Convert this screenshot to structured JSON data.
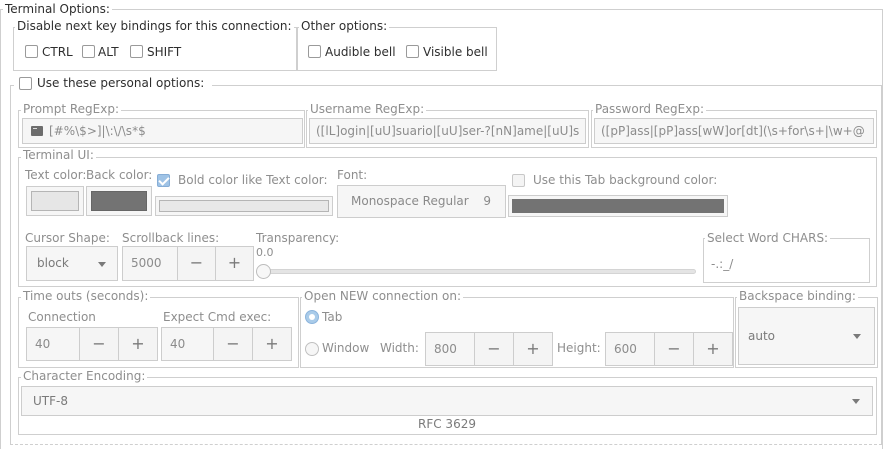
{
  "terminal_options": {
    "title": "Terminal Options:",
    "disable_bindings": {
      "title": "Disable next key bindings for this connection:",
      "ctrl": "CTRL",
      "alt": "ALT",
      "shift": "SHIFT"
    },
    "other_options": {
      "title": "Other options:",
      "audible_bell": "Audible bell",
      "visible_bell": "Visible bell"
    },
    "use_personal": "Use these personal options:"
  },
  "regexp": {
    "prompt_label": "Prompt RegExp:",
    "prompt_value": "[#%\\$>]|\\:\\/\\s*$",
    "username_label": "Username RegExp:",
    "username_value": "([lL]ogin|[uU]suario|[uU]ser-?[nN]ame|[uU]s",
    "password_label": "Password RegExp:",
    "password_value": "([pP]ass|[pP]ass[wW]or[dt](\\s+for\\s+|\\w+@"
  },
  "terminal_ui": {
    "title": "Terminal UI:",
    "text_color_label": "Text color:",
    "back_color_label": "Back color:",
    "bold_like_text": "Bold color like Text color:",
    "font_label": "Font:",
    "font_name": "Monospace Regular",
    "font_size": "9",
    "tab_bg_label": "Use this Tab background color:",
    "cursor_shape_label": "Cursor Shape:",
    "cursor_shape_value": "block",
    "scrollback_label": "Scrollback lines:",
    "scrollback_value": "5000",
    "transparency_label": "Transparency:",
    "transparency_value": "0.0",
    "select_word_label": "Select Word CHARS:",
    "select_word_value": "-.:_/",
    "colors": {
      "text": "#e6e6e6",
      "back": "#737373",
      "bold": "#e8e8e8",
      "tab_bg": "#737373"
    }
  },
  "timeouts": {
    "title": "Time outs (seconds):",
    "connection_label": "Connection",
    "connection_value": "40",
    "expect_label": "Expect Cmd exec:",
    "expect_value": "40"
  },
  "open_new": {
    "title": "Open NEW connection on:",
    "tab": "Tab",
    "window": "Window",
    "width_label": "Width:",
    "width_value": "800",
    "height_label": "Height:",
    "height_value": "600"
  },
  "backspace": {
    "title": "Backspace binding:",
    "value": "auto"
  },
  "encoding": {
    "title": "Character Encoding:",
    "value": "UTF-8",
    "description": "RFC 3629"
  },
  "icons": {
    "minus": "−",
    "plus": "+"
  }
}
